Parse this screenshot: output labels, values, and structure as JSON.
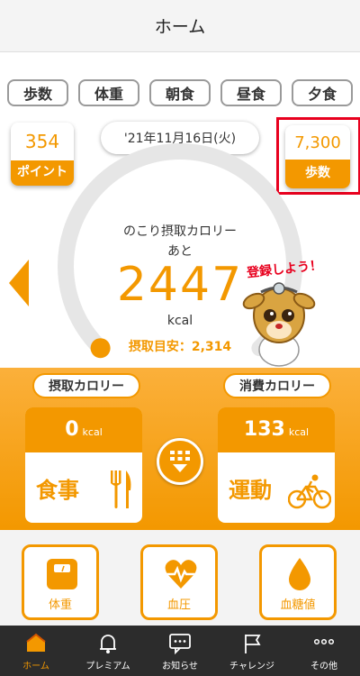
{
  "header": {
    "title": "ホーム"
  },
  "tabs": [
    {
      "label": "歩数"
    },
    {
      "label": "体重"
    },
    {
      "label": "朝食"
    },
    {
      "label": "昼食"
    },
    {
      "label": "夕食"
    }
  ],
  "points": {
    "value": "354",
    "label": "ポイント"
  },
  "date": "'21年11月16日(火)",
  "steps": {
    "value": "7,300",
    "label": "歩数"
  },
  "calories": {
    "remaining_label": "のこり摂取カロリー",
    "remaining_prefix": "あと",
    "remaining_value": "2447",
    "unit": "kcal",
    "target_text": "摂取目安：2,314",
    "gauge_progress": 0.0
  },
  "mascot": {
    "speech": "登録しよう！"
  },
  "intake": {
    "badge": "摂取カロリー",
    "value": "0",
    "unit": "kcal",
    "label": "食事"
  },
  "burn": {
    "badge": "消費カロリー",
    "value": "133",
    "unit": "kcal",
    "label": "運動"
  },
  "tiles": [
    {
      "label": "体重",
      "icon": "scale-icon"
    },
    {
      "label": "血圧",
      "icon": "heart-pulse-icon"
    },
    {
      "label": "血糖値",
      "icon": "drop-icon"
    }
  ],
  "nav": [
    {
      "label": "ホーム",
      "icon": "home-icon",
      "active": true
    },
    {
      "label": "プレミアム",
      "icon": "bell-icon"
    },
    {
      "label": "お知らせ",
      "icon": "chat-icon"
    },
    {
      "label": "チャレンジ",
      "icon": "flag-icon"
    },
    {
      "label": "その他",
      "icon": "more-icon"
    }
  ],
  "colors": {
    "accent": "#f39800",
    "highlight": "#e8001e",
    "nav_bg": "#2c2c2c"
  }
}
